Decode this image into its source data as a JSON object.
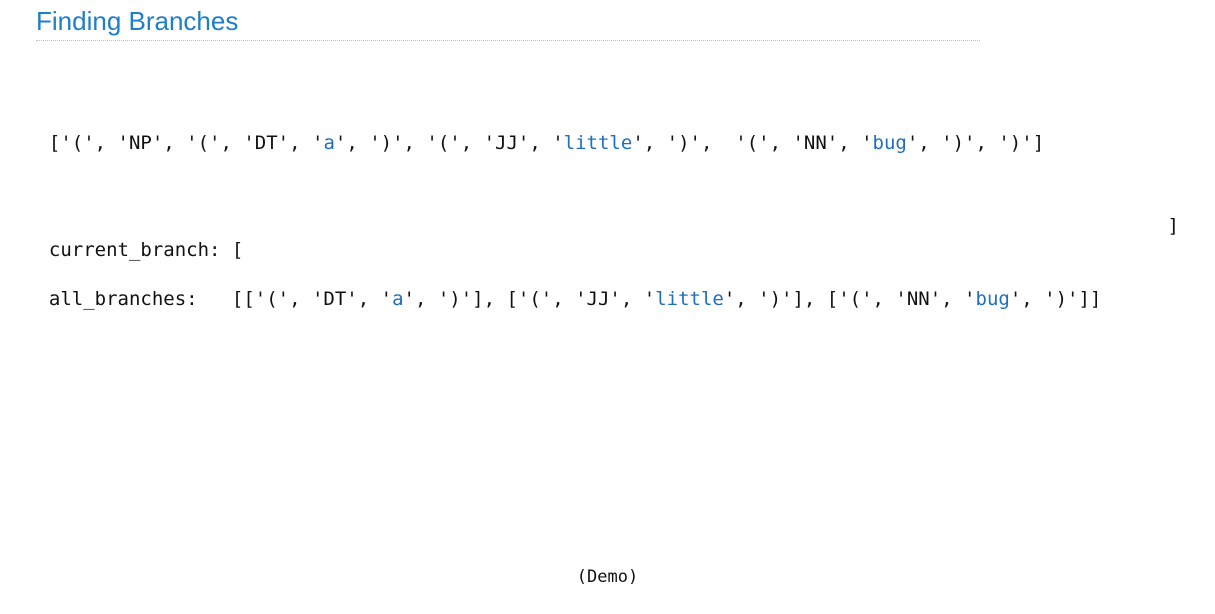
{
  "title": "Finding Branches",
  "colors": {
    "title": "#1e7fc8",
    "word_token": "#1e6fc0",
    "text": "#111111"
  },
  "token_list": [
    {
      "text": "['(', 'NP', '(', 'DT', '",
      "word": false
    },
    {
      "text": "a",
      "word": true
    },
    {
      "text": "', ')', '(', 'JJ', '",
      "word": false
    },
    {
      "text": "little",
      "word": true
    },
    {
      "text": "', ')',  '(', 'NN', '",
      "word": false
    },
    {
      "text": "bug",
      "word": true
    },
    {
      "text": "', ')', ')']",
      "word": false
    }
  ],
  "current_branch": {
    "label": "current_branch: [",
    "close": "]"
  },
  "all_branches": {
    "label": "all_branches:   ",
    "segments": [
      {
        "text": "[['(', 'DT', '",
        "word": false
      },
      {
        "text": "a",
        "word": true
      },
      {
        "text": "', ')'], ['(', 'JJ', '",
        "word": false
      },
      {
        "text": "little",
        "word": true
      },
      {
        "text": "', ')'], ['(', 'NN', '",
        "word": false
      },
      {
        "text": "bug",
        "word": true
      },
      {
        "text": "', ')']]",
        "word": false
      }
    ]
  },
  "demo_label": "(Demo)"
}
